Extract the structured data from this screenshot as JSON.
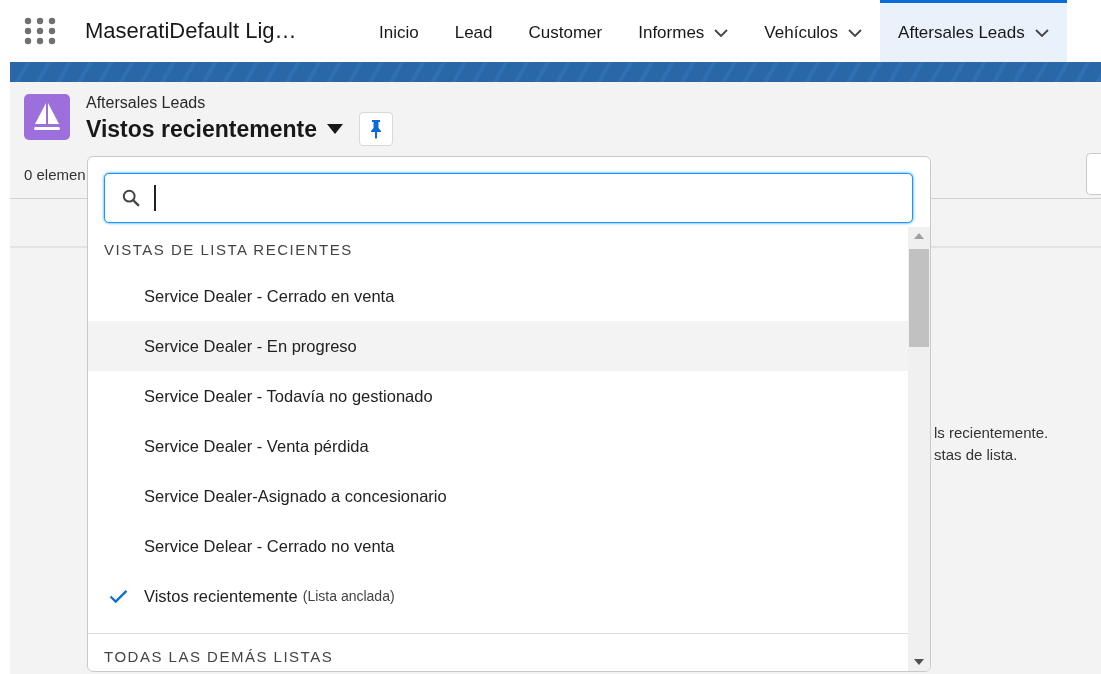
{
  "nav": {
    "app_name": "MaseratiDefault Lig…",
    "tabs": [
      {
        "label": "Inicio",
        "menu": false,
        "selected": false
      },
      {
        "label": "Lead",
        "menu": false,
        "selected": false
      },
      {
        "label": "Customer",
        "menu": false,
        "selected": false
      },
      {
        "label": "Informes",
        "menu": true,
        "selected": false
      },
      {
        "label": "Vehículos",
        "menu": true,
        "selected": false
      },
      {
        "label": "Aftersales Leads",
        "menu": true,
        "selected": true
      }
    ]
  },
  "header": {
    "object": "Aftersales Leads",
    "list_view": "Vistos recientemente",
    "item_count": "0 elemen"
  },
  "empty_state": [
    "ls recientemente.",
    "stas de lista."
  ],
  "dropdown": {
    "sections": [
      {
        "title": "VISTAS DE LISTA RECIENTES",
        "items": [
          {
            "label": "Service Dealer - Cerrado en venta",
            "selected": false,
            "hovered": false
          },
          {
            "label": "Service Dealer - En progreso",
            "selected": false,
            "hovered": true
          },
          {
            "label": "Service Dealer - Todavía no gestionado",
            "selected": false,
            "hovered": false
          },
          {
            "label": "Service Dealer - Venta pérdida",
            "selected": false,
            "hovered": false
          },
          {
            "label": "Service Dealer-Asignado a concesionario",
            "selected": false,
            "hovered": false
          },
          {
            "label": "Service Delear - Cerrado no venta",
            "selected": false,
            "hovered": false
          },
          {
            "label": "Vistos recientemente",
            "note": "(Lista anclada)",
            "selected": true,
            "hovered": false
          }
        ]
      },
      {
        "title": "TODAS LAS DEMÁS LISTAS"
      }
    ]
  }
}
